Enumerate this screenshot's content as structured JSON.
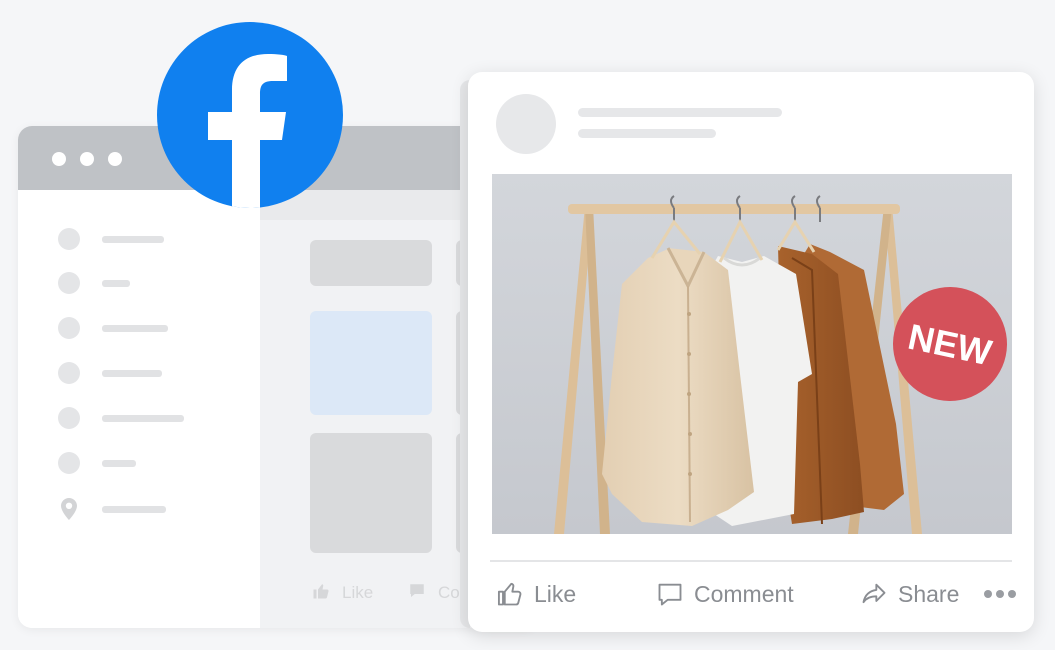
{
  "brand": {
    "logo_icon": "facebook-logo-icon",
    "logo_color": "#1877F2"
  },
  "background_window": {
    "sidebar_icons": [
      "circle-icon",
      "circle-icon",
      "circle-icon",
      "circle-icon",
      "circle-icon",
      "circle-icon",
      "location-pin-icon"
    ],
    "ghost_actions": {
      "like_label": "Like",
      "comment_label": "Co"
    }
  },
  "post": {
    "badge": "NEW",
    "badge_color": "#D94F55",
    "image_subject": "clothing-rack-icon",
    "actions": {
      "like_label": "Like",
      "comment_label": "Comment",
      "share_label": "Share"
    }
  }
}
